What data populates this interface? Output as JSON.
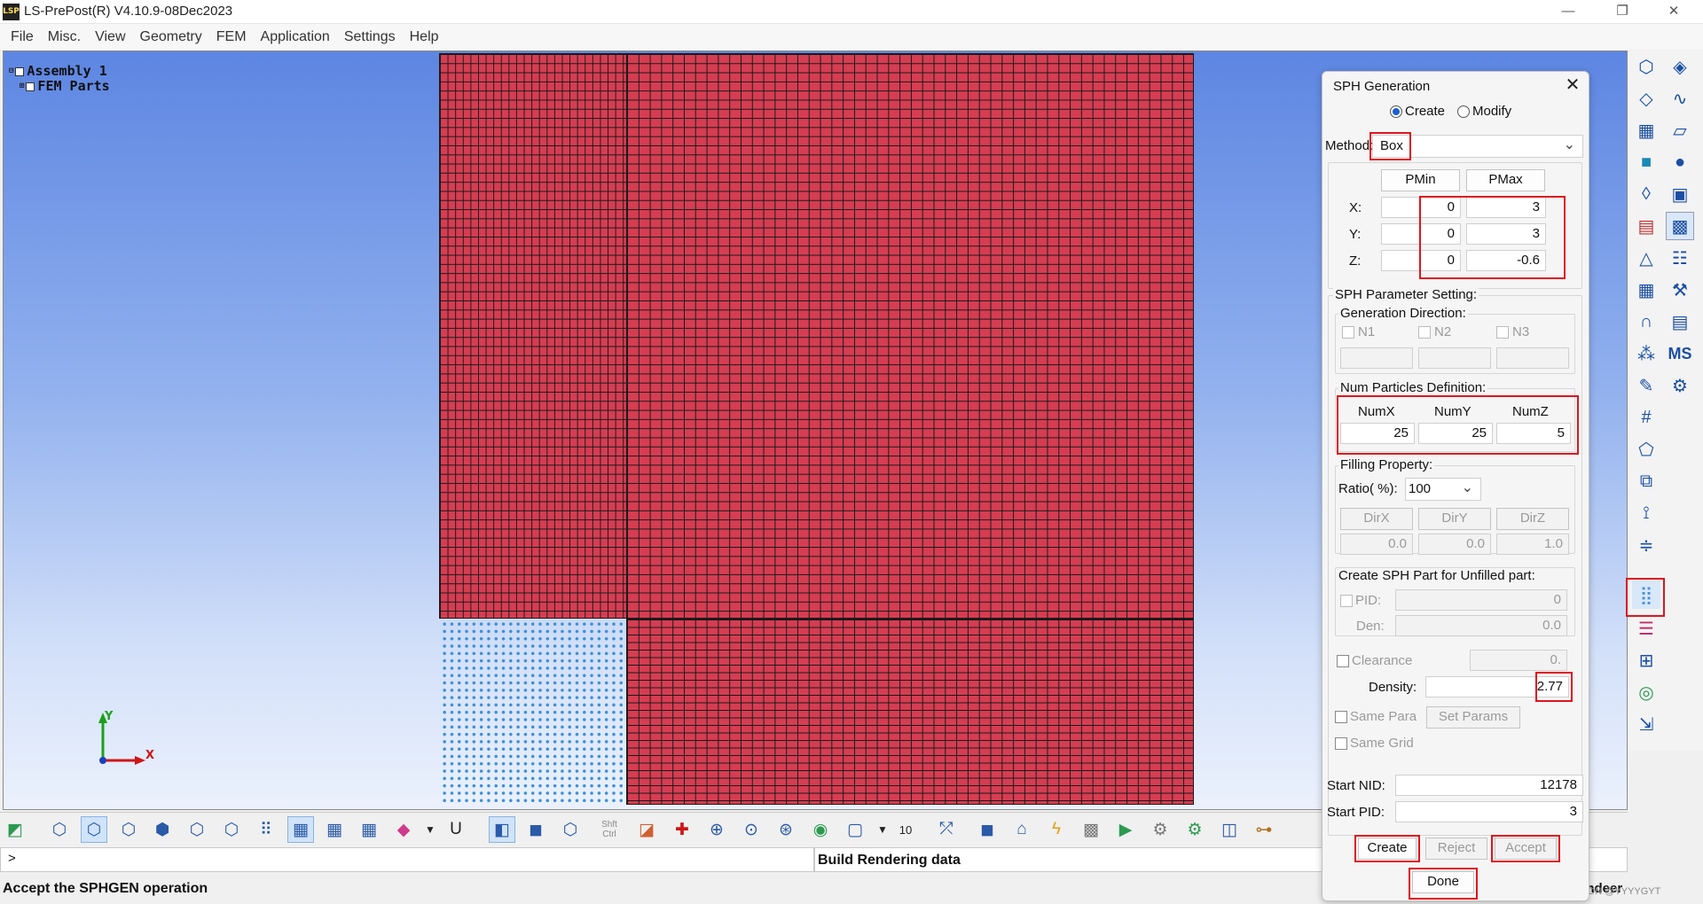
{
  "window": {
    "title": "LS-PrePost(R) V4.10.9-08Dec2023",
    "minimize": "—",
    "maximize": "❐",
    "close": "✕"
  },
  "menu": [
    "File",
    "Misc.",
    "View",
    "Geometry",
    "FEM",
    "Application",
    "Settings",
    "Help"
  ],
  "tree": {
    "assembly": "Assembly 1",
    "parts": "FEM Parts"
  },
  "axis": {
    "y": "Y",
    "x": "X"
  },
  "bottom_toolbar": {
    "shift_ctrl_1": "Shft",
    "shift_ctrl_2": "Ctrl",
    "angle": "10"
  },
  "command_line": {
    "prompt": ">"
  },
  "render_status": "Build Rendering data",
  "status": {
    "message": "Accept the SPHGEN operation",
    "right": "endeer",
    "watermark": "CSDN @YYYYGYT"
  },
  "dialog": {
    "title": "SPH Generation",
    "close": "✕",
    "mode_create": "Create",
    "mode_modify": "Modify",
    "method_label": "Method:",
    "method_value": "Box",
    "pmin": "PMin",
    "pmax": "PMax",
    "x_label": "X:",
    "y_label": "Y:",
    "z_label": "Z:",
    "x_min": "0",
    "x_max": "3",
    "y_min": "0",
    "y_max": "3",
    "z_min": "0",
    "z_max": "-0.6",
    "param_setting": "SPH Parameter Setting:",
    "gen_direction": "Generation Direction:",
    "n1": "N1",
    "n2": "N2",
    "n3": "N3",
    "num_particles": "Num Particles Definition:",
    "numx_label": "NumX",
    "numy_label": "NumY",
    "numz_label": "NumZ",
    "numx": "25",
    "numy": "25",
    "numz": "5",
    "filling_property": "Filling Property:",
    "ratio_label": "Ratio( %):",
    "ratio_value": "100",
    "dirx": "DirX",
    "diry": "DirY",
    "dirz": "DirZ",
    "dirx_val": "0.0",
    "diry_val": "0.0",
    "dirz_val": "1.0",
    "unfilled_part": "Create SPH Part for Unfilled part:",
    "pid_label": "PID:",
    "pid_value": "0",
    "den_label": "Den:",
    "den_value": "0.0",
    "clearance_label": "Clearance",
    "clearance_value": "0.",
    "density_label": "Density:",
    "density_value": "2.77",
    "same_para": "Same Para",
    "set_params": "Set Params",
    "same_grid": "Same Grid",
    "start_nid_label": "Start NID:",
    "start_nid": "12178",
    "start_pid_label": "Start PID:",
    "start_pid": "3",
    "create_btn": "Create",
    "reject_btn": "Reject",
    "accept_btn": "Accept",
    "done_btn": "Done"
  }
}
